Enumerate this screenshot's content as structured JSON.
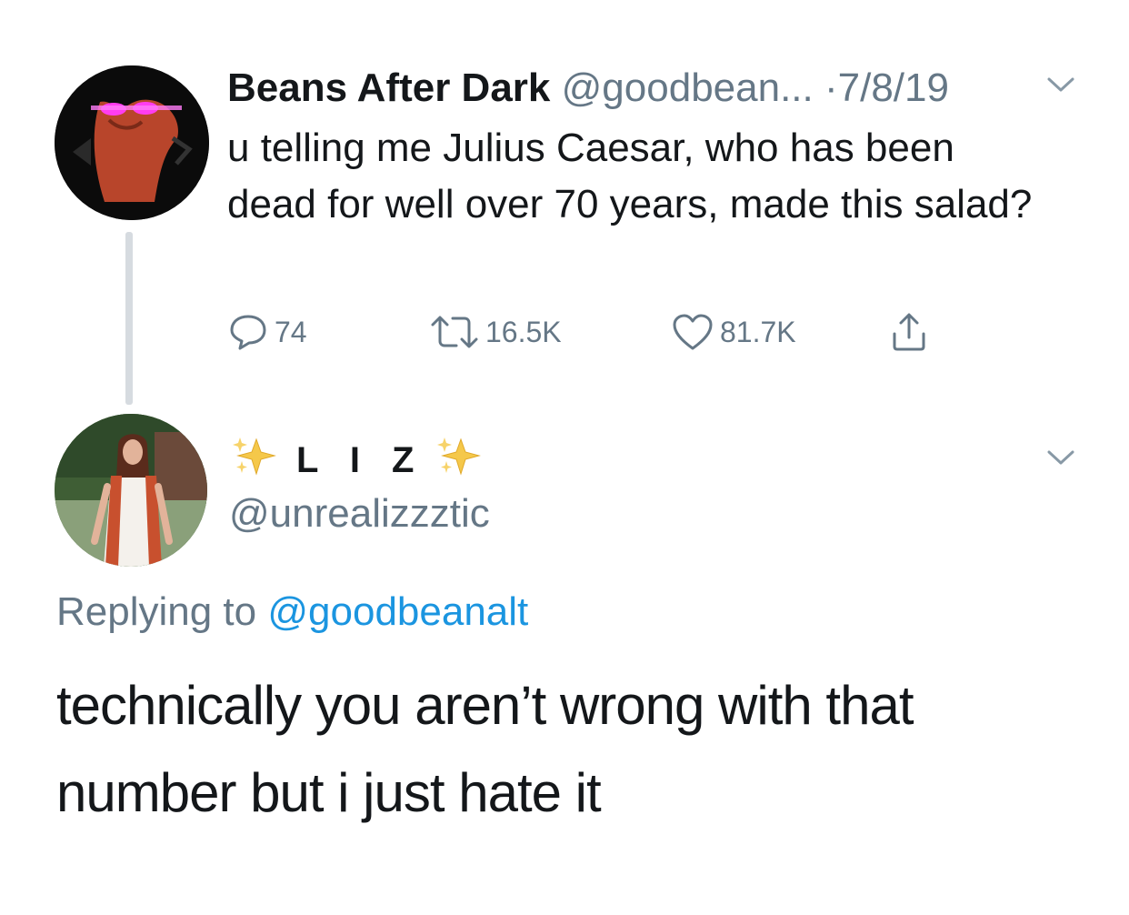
{
  "tweet": {
    "author_name": "Beans After Dark",
    "handle": "@goodbean...",
    "separator": "·",
    "date": "7/8/19",
    "text": "u telling me Julius Caesar, who has been dead for well over 70 years, made this salad?",
    "actions": {
      "replies": "74",
      "retweets": "16.5K",
      "likes": "81.7K"
    }
  },
  "reply": {
    "author_name": "L I Z",
    "sparkle_emoji": "✨",
    "handle": "@unrealizzztic",
    "replying_prefix": "Replying to",
    "replying_to": "@goodbeanalt",
    "text": "technically you aren’t wrong with that number but i just hate it"
  },
  "colors": {
    "primary_text": "#14171a",
    "secondary_text": "#657786",
    "link": "#1b95e0",
    "thread_line": "#d6dbe0"
  },
  "icons": [
    "reply-icon",
    "retweet-icon",
    "like-icon",
    "share-icon",
    "chevron-down-icon",
    "sparkles-icon"
  ]
}
